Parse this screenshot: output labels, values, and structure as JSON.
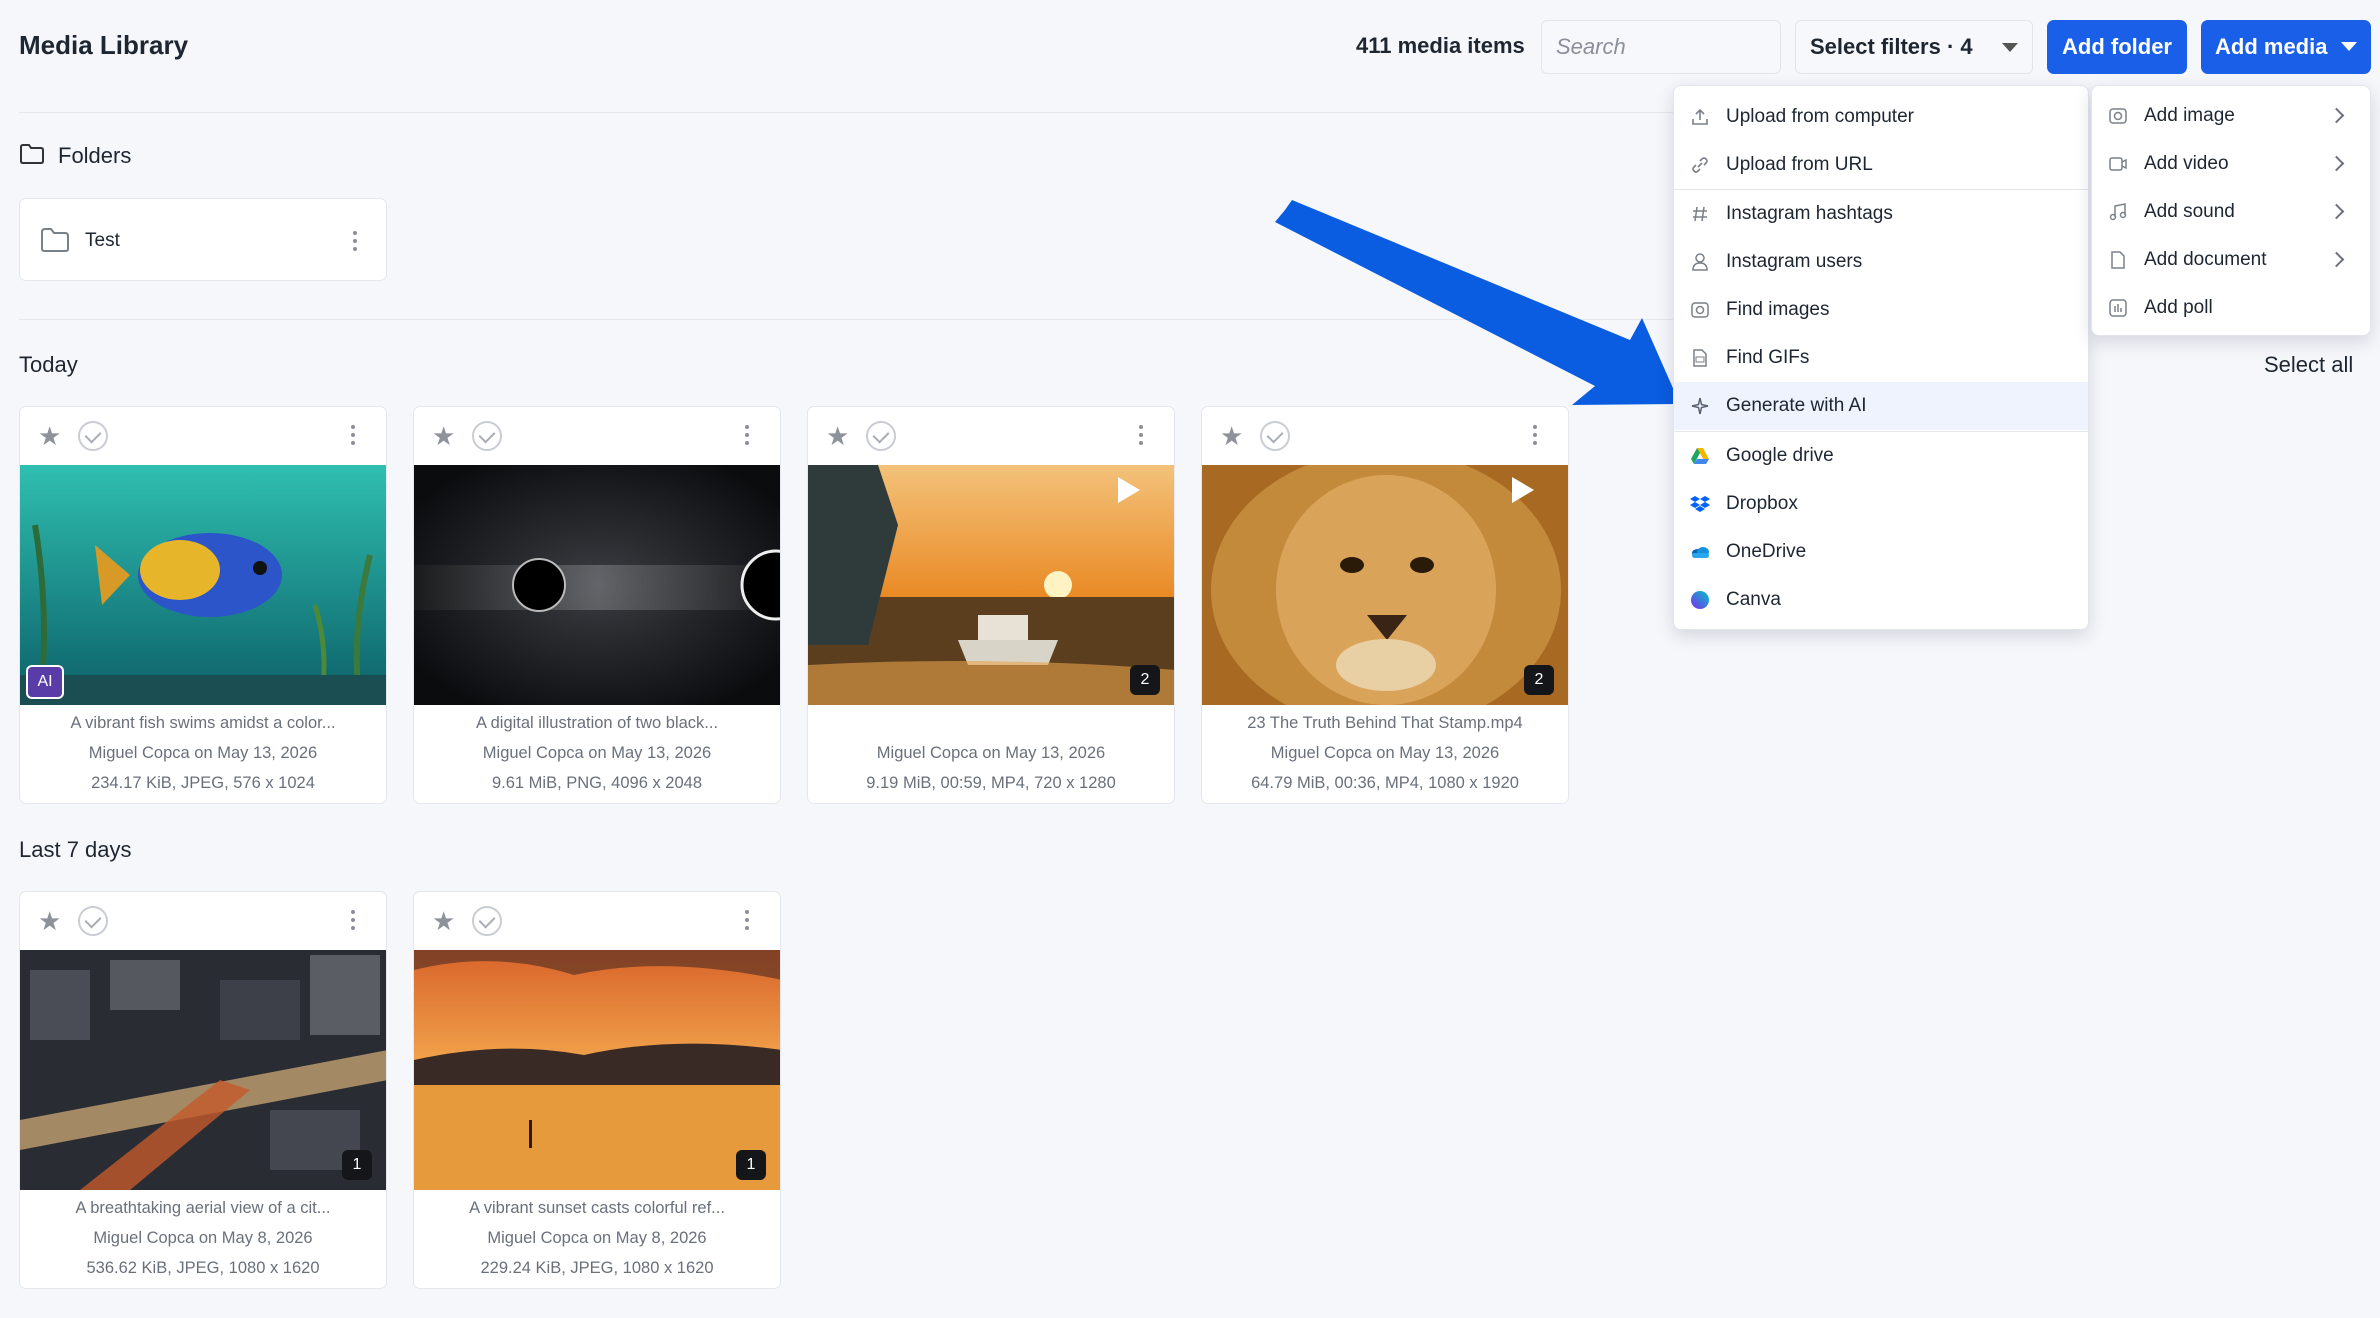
{
  "header": {
    "title": "Media Library",
    "item_count": "411 media items",
    "search_placeholder": "Search",
    "filters_label": "Select filters · 4",
    "add_folder_label": "Add folder",
    "add_media_label": "Add media"
  },
  "folders": {
    "title": "Folders",
    "items": [
      {
        "name": "Test"
      }
    ]
  },
  "sections": {
    "today": "Today",
    "last7": "Last 7 days",
    "select_all": "Select all"
  },
  "media": [
    {
      "caption": "A vibrant fish swims amidst a color...",
      "author": "Miguel Copca on May 13, 2026",
      "info": "234.17 KiB, JPEG, 576 x 1024",
      "badge": "AI"
    },
    {
      "caption": "A digital illustration of two black...",
      "author": "Miguel Copca on May 13, 2026",
      "info": "9.61 MiB, PNG, 4096 x 2048"
    },
    {
      "caption": "",
      "author": "Miguel Copca on May 13, 2026",
      "info": "9.19 MiB, 00:59, MP4, 720 x 1280",
      "count": "2"
    },
    {
      "caption": "23 The Truth Behind That Stamp.mp4",
      "author": "Miguel Copca on May 13, 2026",
      "info": "64.79 MiB, 00:36, MP4, 1080 x 1920",
      "count": "2"
    },
    {
      "caption": "A breathtaking aerial view of a cit...",
      "author": "Miguel Copca on May 8, 2026",
      "info": "536.62 KiB, JPEG, 1080 x 1620",
      "count": "1"
    },
    {
      "caption": "A vibrant sunset casts colorful ref...",
      "author": "Miguel Copca on May 8, 2026",
      "info": "229.24 KiB, JPEG, 1080 x 1620",
      "count": "1"
    }
  ],
  "menu_main": [
    {
      "label": "Upload from computer",
      "icon": "upload-icon"
    },
    {
      "label": "Upload from URL",
      "icon": "link-icon"
    },
    {
      "label": "Instagram hashtags",
      "icon": "hashtag-icon"
    },
    {
      "label": "Instagram users",
      "icon": "user-icon"
    },
    {
      "label": "Find images",
      "icon": "camera-icon"
    },
    {
      "label": "Find GIFs",
      "icon": "gif-icon"
    },
    {
      "label": "Generate with AI",
      "icon": "sparkle-icon"
    },
    {
      "label": "Google drive",
      "icon": "google-drive-icon"
    },
    {
      "label": "Dropbox",
      "icon": "dropbox-icon"
    },
    {
      "label": "OneDrive",
      "icon": "onedrive-icon"
    },
    {
      "label": "Canva",
      "icon": "canva-icon"
    }
  ],
  "menu_side": [
    {
      "label": "Add image",
      "icon": "camera-icon"
    },
    {
      "label": "Add video",
      "icon": "video-icon"
    },
    {
      "label": "Add sound",
      "icon": "music-icon"
    },
    {
      "label": "Add document",
      "icon": "document-icon"
    },
    {
      "label": "Add poll",
      "icon": "poll-icon"
    }
  ],
  "colors": {
    "accent": "#1a5fe8",
    "highlight": "#eef3fe",
    "ai_badge": "#5a3ca8"
  }
}
